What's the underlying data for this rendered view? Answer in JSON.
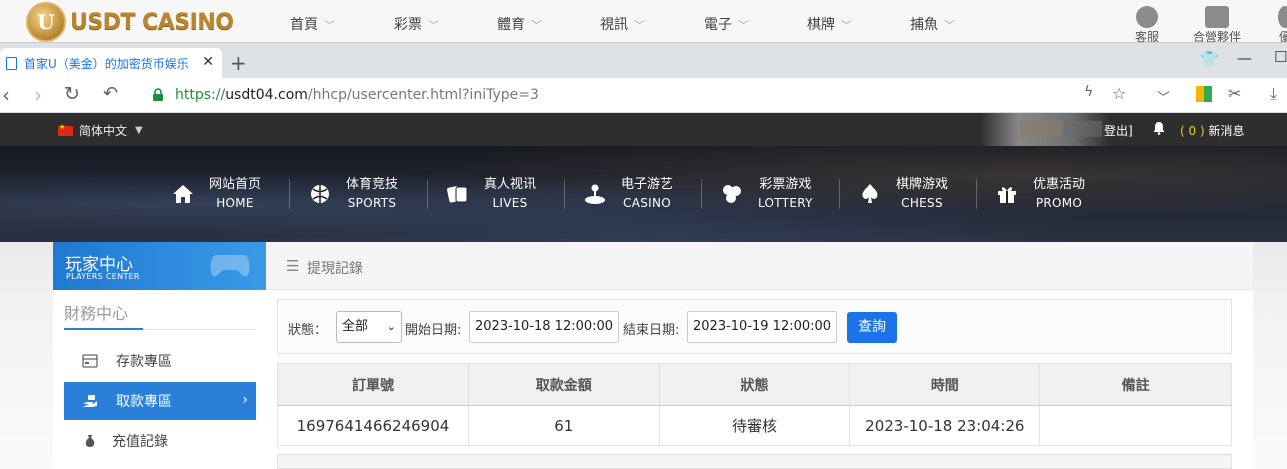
{
  "site_header": {
    "logo_text": "USDT CASINO",
    "logo_letter": "U",
    "nav": [
      "首頁",
      "彩票",
      "體育",
      "視訊",
      "電子",
      "棋牌",
      "捕魚"
    ],
    "right": [
      "客服",
      "合營夥伴",
      "優"
    ]
  },
  "browser": {
    "tab_title": "首家U（美金）的加密货币娱乐",
    "new_tab": "+",
    "url_scheme": "https://",
    "url_host": "usdt04.com",
    "url_path": "/hhcp/usercenter.html?iniType=3"
  },
  "userbar": {
    "language": "简体中文",
    "logout": "登出]",
    "msg_count": "( 0 )",
    "msg_label": "新消息"
  },
  "main_nav": [
    {
      "cn": "网站首页",
      "en": "HOME",
      "icon": "home-icon"
    },
    {
      "cn": "体育竞技",
      "en": "SPORTS",
      "icon": "ball-icon"
    },
    {
      "cn": "真人视讯",
      "en": "LIVES",
      "icon": "cards-icon"
    },
    {
      "cn": "电子游艺",
      "en": "CASINO",
      "icon": "joystick-icon"
    },
    {
      "cn": "彩票游戏",
      "en": "LOTTERY",
      "icon": "balls-icon"
    },
    {
      "cn": "棋牌游戏",
      "en": "CHESS",
      "icon": "spade-icon"
    },
    {
      "cn": "优惠活动",
      "en": "PROMO",
      "icon": "gift-icon"
    }
  ],
  "sidebar": {
    "center_cn": "玩家中心",
    "center_en": "PLAYERS CENTER",
    "section": "財務中心",
    "items": [
      {
        "label": "存款專區",
        "active": false
      },
      {
        "label": "取款專區",
        "active": true
      },
      {
        "label": "充值記錄",
        "active": false
      }
    ]
  },
  "content": {
    "title": "提現記錄",
    "filter": {
      "status_label": "狀態：",
      "status_value": "全部",
      "start_label": "開始日期:",
      "start_value": "2023-10-18 12:00:00",
      "end_label": "結束日期:",
      "end_value": "2023-10-19 12:00:00",
      "query_button": "查詢"
    },
    "table": {
      "headers": [
        "訂單號",
        "取款金額",
        "狀態",
        "時間",
        "備註"
      ],
      "rows": [
        [
          "1697641466246904",
          "61",
          "待審核",
          "2023-10-18 23:04:26",
          ""
        ]
      ]
    }
  },
  "colors": {
    "accent": "#2a7fd8",
    "query_button": "#1a73e8",
    "userbar_bg": "#2e2e2e",
    "msg_count": "#f5c518"
  }
}
